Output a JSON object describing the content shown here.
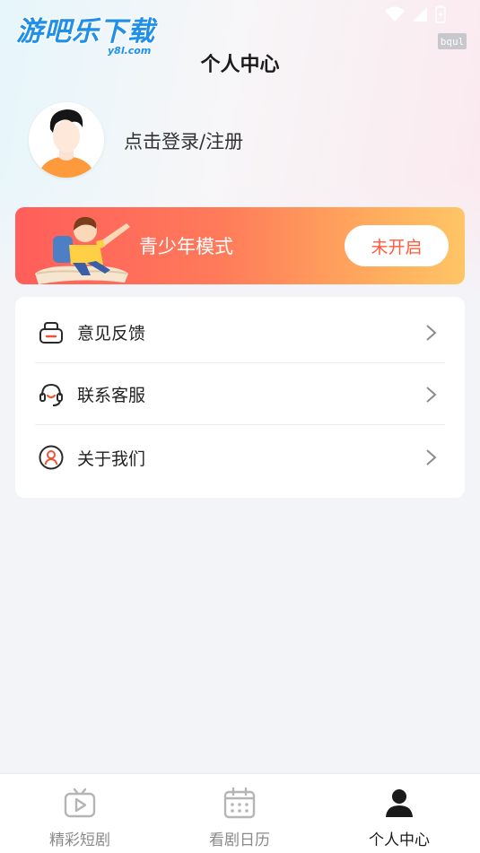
{
  "watermark": {
    "main": "游吧乐下载",
    "sub": "y8l.com",
    "tag": "bqul"
  },
  "header": {
    "title": "个人中心"
  },
  "profile": {
    "login_prompt": "点击登录/注册"
  },
  "youth_mode": {
    "label": "青少年模式",
    "status": "未开启"
  },
  "menu": {
    "items": [
      {
        "label": "意见反馈",
        "icon": "feedback-icon"
      },
      {
        "label": "联系客服",
        "icon": "headset-icon"
      },
      {
        "label": "关于我们",
        "icon": "person-circle-icon"
      }
    ]
  },
  "tabbar": {
    "tabs": [
      {
        "label": "精彩短剧",
        "icon": "tv-play-icon",
        "active": false
      },
      {
        "label": "看剧日历",
        "icon": "calendar-icon",
        "active": false
      },
      {
        "label": "个人中心",
        "icon": "person-icon",
        "active": true
      }
    ]
  },
  "colors": {
    "accent": "#ff5a3c",
    "menu_icon": "#e8573c",
    "background": "#f3f4f8"
  }
}
